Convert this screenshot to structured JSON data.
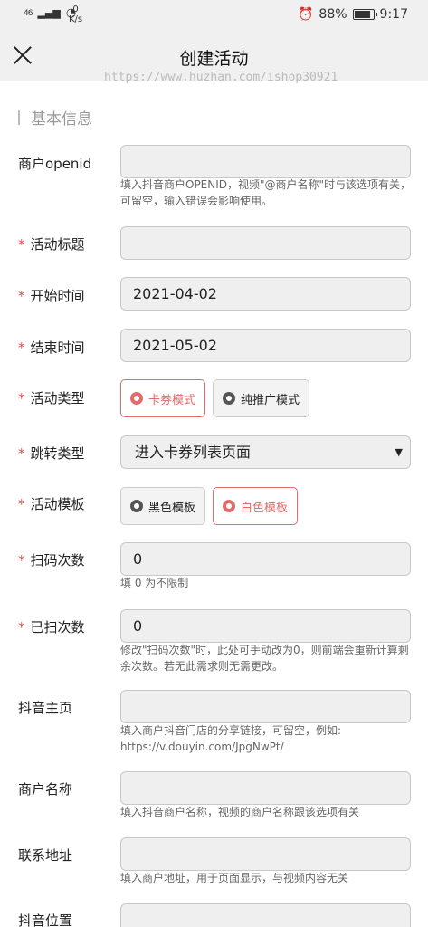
{
  "status_bar": {
    "signal": "46",
    "speed_value": "0",
    "speed_unit": "K/s",
    "battery": "88%",
    "time": "9:17",
    "battery_level": 0.88
  },
  "nav": {
    "title": "创建活动",
    "watermark": "https://www.huzhan.com/ishop30921"
  },
  "section": {
    "title": "基本信息"
  },
  "fields": {
    "merchant_openid": {
      "label": "商户openid",
      "value": "",
      "hint": "填入抖音商户OPENID，视频\"@商户名称\"时与该选项有关，可留空，输入错误会影响使用。"
    },
    "activity_title": {
      "label": "活动标题",
      "value": ""
    },
    "start_time": {
      "label": "开始时间",
      "value": "2021-04-02"
    },
    "end_time": {
      "label": "结束时间",
      "value": "2021-05-02"
    },
    "activity_type": {
      "label": "活动类型",
      "options": [
        "卡券模式",
        "纯推广模式"
      ],
      "selected": "卡券模式"
    },
    "jump_type": {
      "label": "跳转类型",
      "value": "进入卡券列表页面"
    },
    "activity_template": {
      "label": "活动模板",
      "options": [
        "黑色模板",
        "白色模板"
      ],
      "selected": "白色模板"
    },
    "scan_count": {
      "label": "扫码次数",
      "value": "0",
      "hint": "填 0 为不限制"
    },
    "scanned_count": {
      "label": "已扫次数",
      "value": "0",
      "hint": "修改\"扫码次数\"时，此处可手动改为0，则前端会重新计算剩余次数。若无此需求则无需更改。"
    },
    "douyin_home": {
      "label": "抖音主页",
      "value": "",
      "hint": "填入商户抖音门店的分享链接，可留空，例如: https://v.douyin.com/JpgNwPt/"
    },
    "merchant_name": {
      "label": "商户名称",
      "value": "",
      "hint": "填入抖音商户名称，视频的商户名称跟该选项有关"
    },
    "contact_address": {
      "label": "联系地址",
      "value": "",
      "hint": "填入商户地址，用于页面显示，与视频内容无关"
    },
    "douyin_location": {
      "label": "抖音位置",
      "value": ""
    }
  }
}
